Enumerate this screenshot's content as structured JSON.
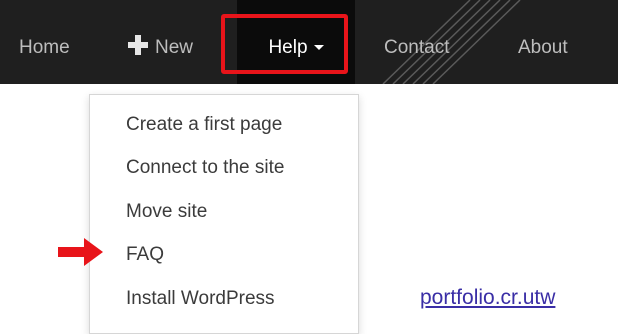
{
  "navbar": {
    "items": [
      {
        "label": "Home"
      },
      {
        "label": "New",
        "icon": "plus-icon"
      },
      {
        "label": "Help",
        "icon": "caret-down-icon",
        "active": true
      },
      {
        "label": "Contact"
      },
      {
        "label": "About"
      }
    ]
  },
  "help_menu": {
    "items": [
      {
        "label": "Create a first page"
      },
      {
        "label": "Connect to the site"
      },
      {
        "label": "Move site"
      },
      {
        "label": "FAQ",
        "pointed": true
      },
      {
        "label": "Install WordPress"
      }
    ]
  },
  "annotation": {
    "highlight_color": "#e8141a",
    "arrow_icon": "red-arrow-icon"
  },
  "footer_link": {
    "text": "portfolio.cr.utw"
  },
  "colors": {
    "navbar_bg": "#1f1f1f",
    "active_bg": "#0b0b0b",
    "nav_text": "#bdbdbd",
    "link": "#3a2ea6"
  }
}
